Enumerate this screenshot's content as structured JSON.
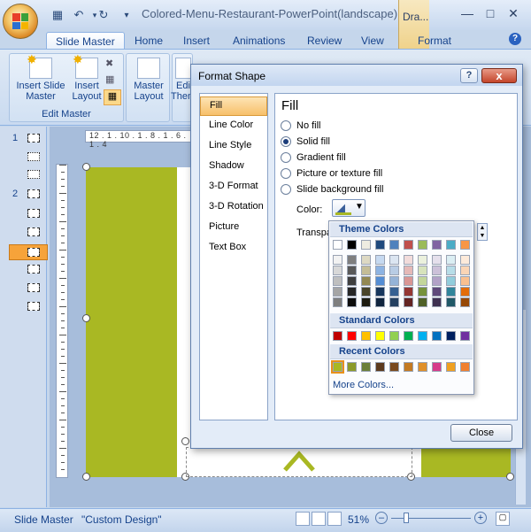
{
  "window": {
    "title": "Colored-Menu-Restaurant-PowerPoint(landscape) - M",
    "contextual_tab": "Dra..."
  },
  "tabs": [
    "Slide Master",
    "Home",
    "Insert",
    "Animations",
    "Review",
    "View",
    "Format"
  ],
  "ribbon": {
    "insert_slide_master": "Insert Slide\nMaster",
    "insert_layout": "Insert\nLayout",
    "group_edit_master": "Edit Master",
    "master_layout": "Master\nLayout",
    "edit_theme": "Edi\nThem"
  },
  "ruler_text": "12 . 1 . 10 . 1 . 8 . 1 . 6 . 1 . 4",
  "thumbnails": {
    "n1": "1",
    "n2": "2"
  },
  "status": {
    "view": "Slide Master",
    "theme": "\"Custom Design\"",
    "zoom": "51%"
  },
  "dialog": {
    "title": "Format Shape",
    "close_x": "x",
    "help": "?",
    "categories": [
      "Fill",
      "Line Color",
      "Line Style",
      "Shadow",
      "3-D Format",
      "3-D Rotation",
      "Picture",
      "Text Box"
    ],
    "fill_heading": "Fill",
    "options": [
      "No fill",
      "Solid fill",
      "Gradient fill",
      "Picture or texture fill",
      "Slide background fill"
    ],
    "color_label": "Color:",
    "transparency_label": "Transpa",
    "close_button": "Close"
  },
  "palette": {
    "theme_heading": "Theme Colors",
    "standard_heading": "Standard Colors",
    "recent_heading": "Recent Colors",
    "more": "More Colors...",
    "theme_top": [
      "#ffffff",
      "#000000",
      "#eeece1",
      "#1f497d",
      "#4f81bd",
      "#c0504d",
      "#9bbb59",
      "#8064a2",
      "#4bacc6",
      "#f79646"
    ],
    "theme_shades": [
      [
        "#f2f2f2",
        "#7f7f7f",
        "#ddd9c3",
        "#c6d9f0",
        "#dbe5f1",
        "#f2dcdb",
        "#ebf1dd",
        "#e5e0ec",
        "#dbeef3",
        "#fdeada"
      ],
      [
        "#d8d8d8",
        "#595959",
        "#c4bd97",
        "#8db3e2",
        "#b8cce4",
        "#e5b9b7",
        "#d7e3bc",
        "#ccc1d9",
        "#b7dde8",
        "#fbd5b5"
      ],
      [
        "#bfbfbf",
        "#3f3f3f",
        "#938953",
        "#548dd4",
        "#95b3d7",
        "#d99694",
        "#c3d69b",
        "#b2a2c7",
        "#92cddc",
        "#fac08f"
      ],
      [
        "#a5a5a5",
        "#262626",
        "#494429",
        "#17365d",
        "#366092",
        "#953734",
        "#76923c",
        "#5f497a",
        "#31859b",
        "#e36c09"
      ],
      [
        "#7f7f7f",
        "#0c0c0c",
        "#1d1b10",
        "#0f243e",
        "#244061",
        "#632423",
        "#4f6128",
        "#3f3151",
        "#205867",
        "#974806"
      ]
    ],
    "standard": [
      "#c00000",
      "#ff0000",
      "#ffc000",
      "#ffff00",
      "#92d050",
      "#00b050",
      "#00b0f0",
      "#0070c0",
      "#002060",
      "#7030a0"
    ],
    "recent": [
      "#a9b823",
      "#8c9a2a",
      "#6b7f3a",
      "#5c3a1e",
      "#7a4a1f",
      "#c47a22",
      "#e0902a",
      "#d63b8a",
      "#f0a020",
      "#f08030"
    ]
  }
}
